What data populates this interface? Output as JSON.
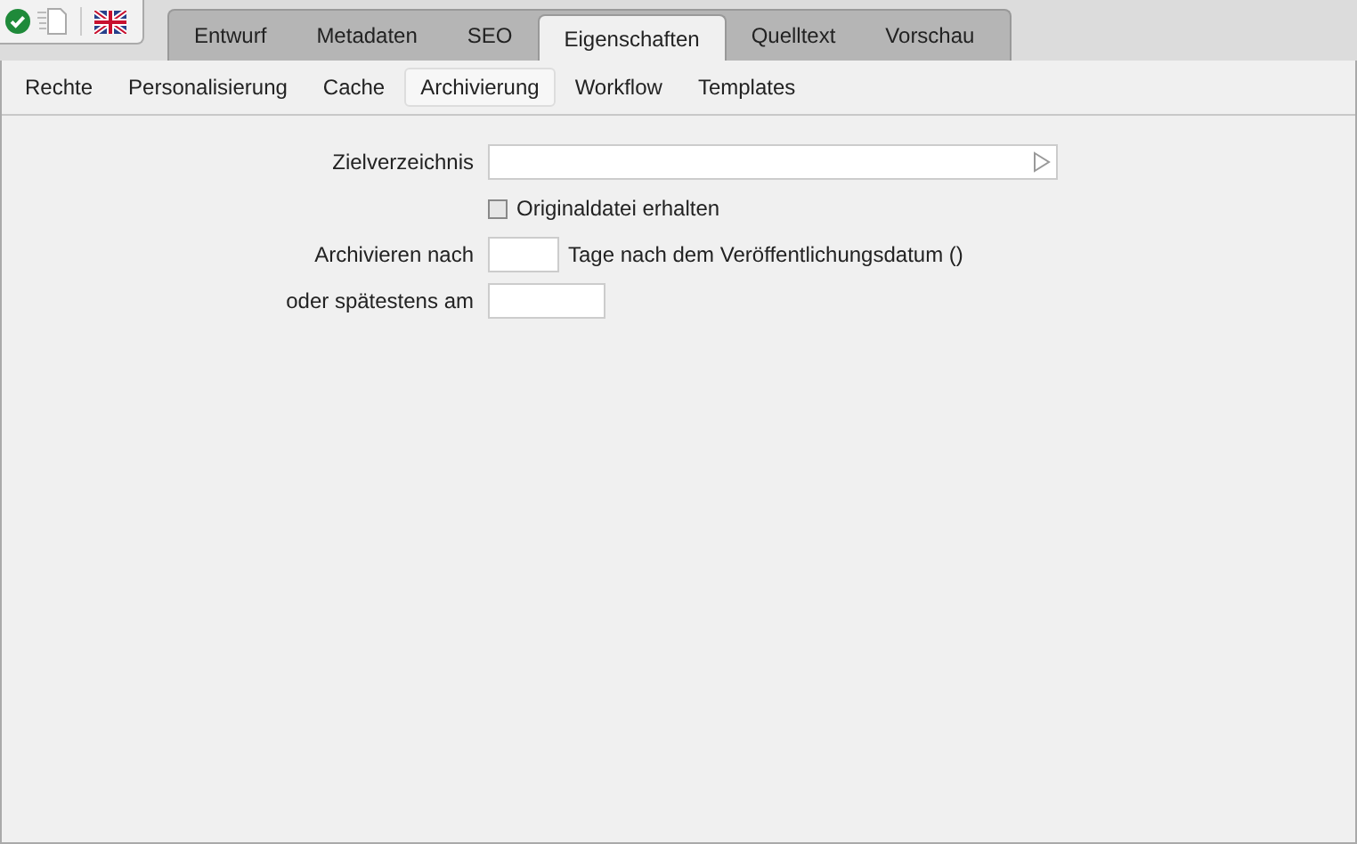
{
  "tabs": [
    {
      "label": "Entwurf",
      "selected": false
    },
    {
      "label": "Metadaten",
      "selected": false
    },
    {
      "label": "SEO",
      "selected": false
    },
    {
      "label": "Eigenschaften",
      "selected": true
    },
    {
      "label": "Quelltext",
      "selected": false
    },
    {
      "label": "Vorschau",
      "selected": false
    }
  ],
  "subtabs": [
    {
      "label": "Rechte",
      "selected": false
    },
    {
      "label": "Personalisierung",
      "selected": false
    },
    {
      "label": "Cache",
      "selected": false
    },
    {
      "label": "Archivierung",
      "selected": true
    },
    {
      "label": "Workflow",
      "selected": false
    },
    {
      "label": "Templates",
      "selected": false
    }
  ],
  "form": {
    "target_label": "Zielverzeichnis",
    "keep_original": {
      "label": "Originaldatei erhalten",
      "checked": false
    },
    "archive_after_label": "Archivieren nach",
    "archive_after_suffix": "Tage nach dem Veröffentlichungsdatum ()",
    "latest_label": "oder spätestens am"
  }
}
